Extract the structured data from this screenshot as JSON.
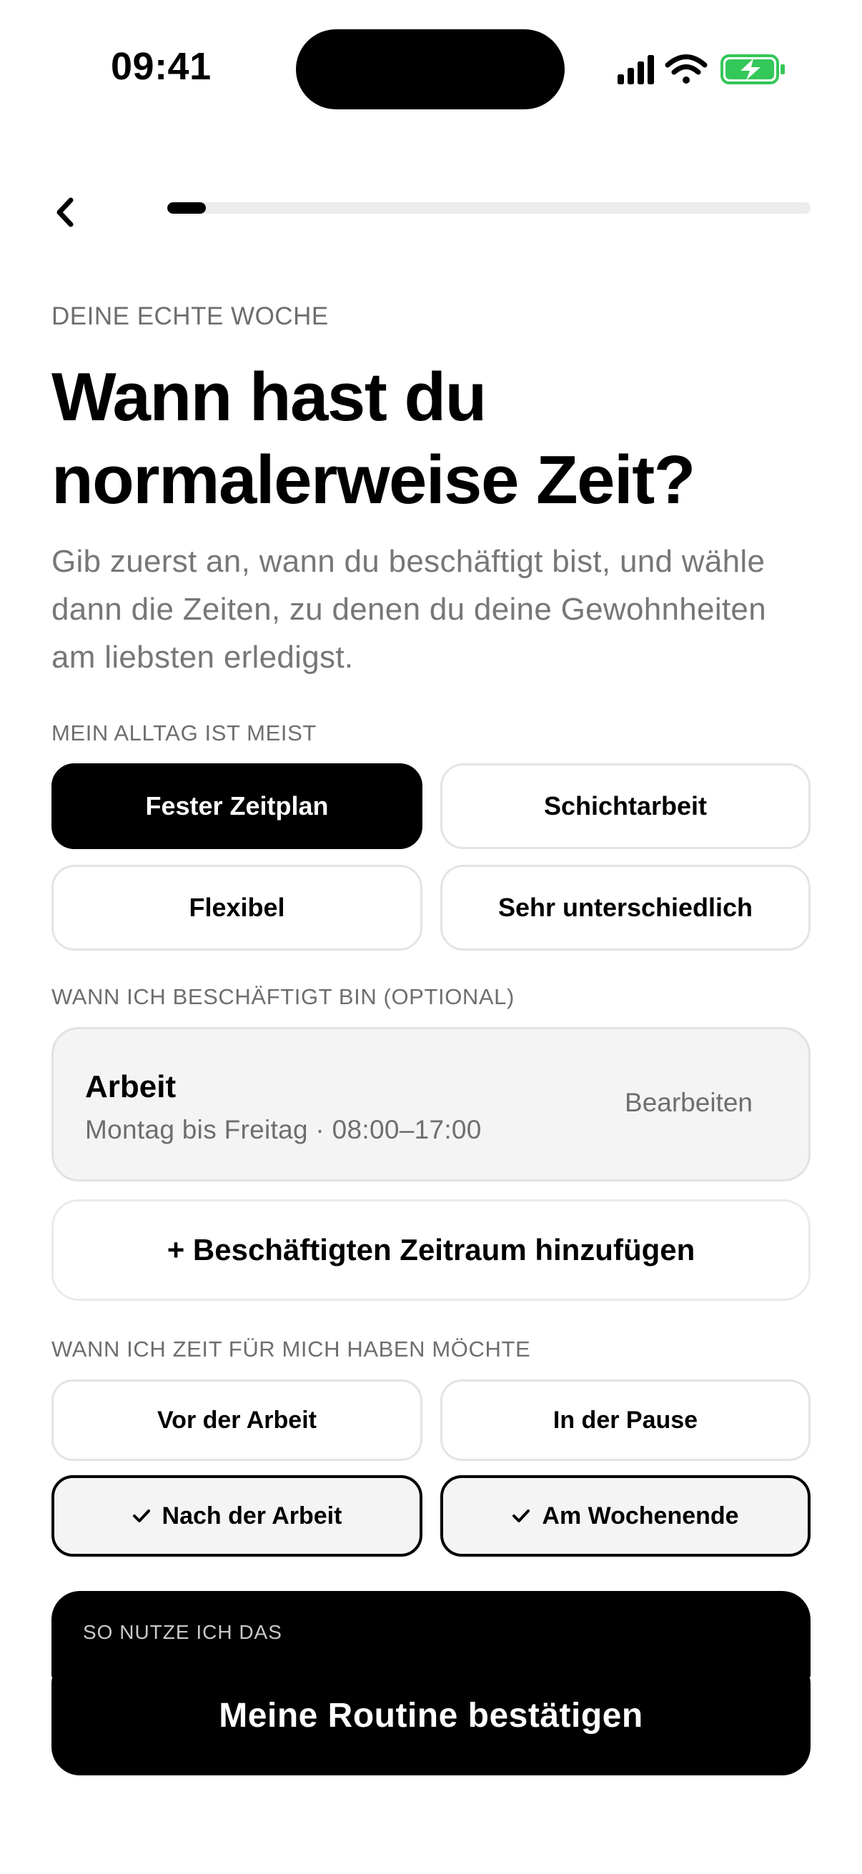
{
  "status_bar": {
    "time": "09:41",
    "icons": [
      "signal-icon",
      "wifi-icon",
      "battery-charging-icon"
    ],
    "battery_color": "#34c759"
  },
  "nav": {
    "back_icon": "chevron-left-icon",
    "progress": 0.06
  },
  "header": {
    "eyebrow": "DEINE ECHTE WOCHE",
    "title": "Wann hast du normalerweise Zeit?",
    "subtitle": "Gib zuerst an, wann du beschäftigt bist, und wähle dann die Zeiten, zu denen du deine Gewohnheiten am liebsten erledigst."
  },
  "schedule_type": {
    "label": "MEIN ALLTAG IST MEIST",
    "options": [
      {
        "label": "Fester Zeitplan",
        "selected": true
      },
      {
        "label": "Schichtarbeit",
        "selected": false
      },
      {
        "label": "Flexibel",
        "selected": false
      },
      {
        "label": "Sehr unterschiedlich",
        "selected": false
      }
    ]
  },
  "busy": {
    "label": "WANN ICH BESCHÄFTIGT BIN (OPTIONAL)",
    "item": {
      "title": "Arbeit",
      "subtitle": "Montag bis Freitag · 08:00–17:00",
      "edit_label": "Bearbeiten"
    },
    "add_label": "+ Beschäftigten Zeitraum hinzufügen"
  },
  "me_time": {
    "label": "WANN ICH ZEIT FÜR MICH HABEN MÖCHTE",
    "options": [
      {
        "label": "Vor der Arbeit",
        "checked": false
      },
      {
        "label": "In der Pause",
        "checked": false
      },
      {
        "label": "Nach der Arbeit",
        "checked": true
      },
      {
        "label": "Am Wochenende",
        "checked": true
      }
    ]
  },
  "usage_card": {
    "label": "SO NUTZE ICH DAS"
  },
  "cta": {
    "label": "Meine Routine bestätigen"
  }
}
